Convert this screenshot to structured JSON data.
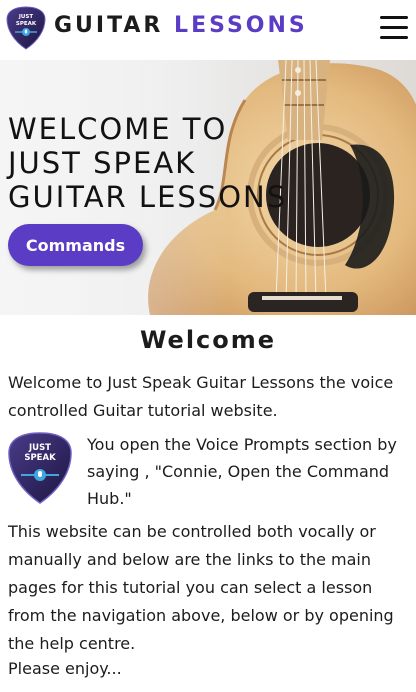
{
  "header": {
    "logo_text_line1": "JUST",
    "logo_text_line2": "SPEAK",
    "brand_word1": "GUITAR",
    "brand_word2": "LESSONS",
    "menu_icon": "hamburger-menu-icon"
  },
  "hero": {
    "title_line1": "WELCOME TO",
    "title_line2": "JUST SPEAK",
    "title_line3": "GUITAR LESSONS",
    "button_label": "Commands"
  },
  "content": {
    "heading": "Welcome",
    "intro": "Welcome to Just Speak Guitar Lessons the voice controlled Guitar tutorial website.",
    "voice_prompt": "You open the Voice Prompts section by saying , \"Connie, Open the Command Hub.\"",
    "body": "This website can be controlled both vocally or manually and below are the links to the main pages for this tutorial you can select a lesson from the navigation above, below or by opening the help centre.",
    "closing": "Please enjoy..."
  },
  "colors": {
    "accent": "#5b3cc4",
    "text": "#1c1c1c",
    "pick_dark": "#2a1f56"
  }
}
